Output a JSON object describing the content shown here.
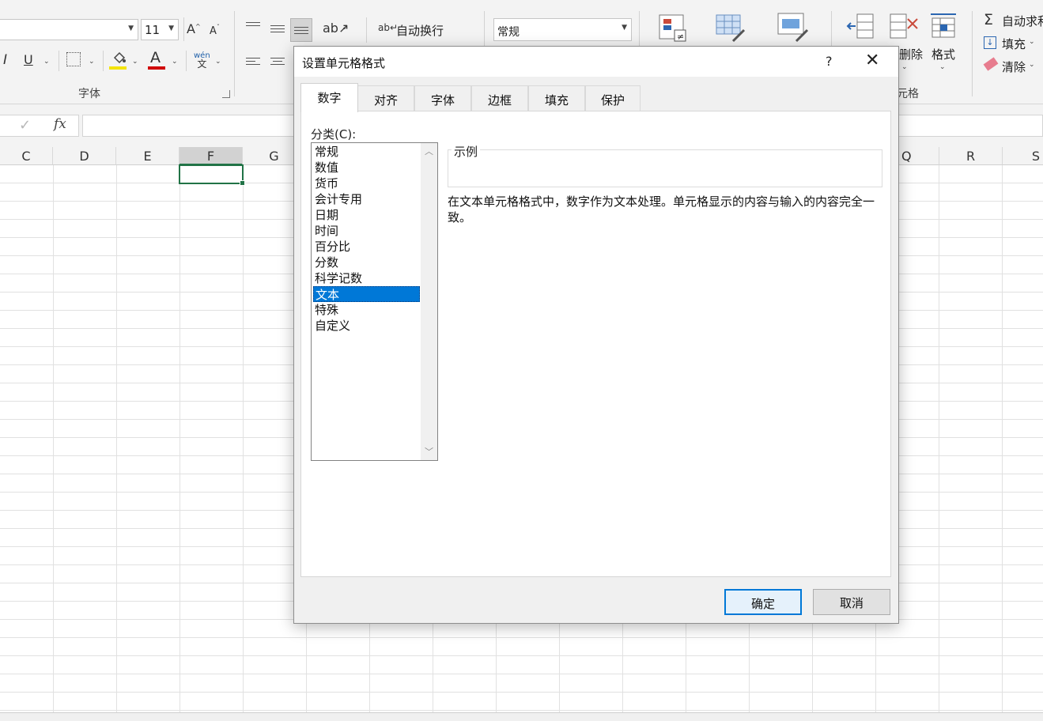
{
  "ribbon": {
    "font_name": "",
    "font_size": "11",
    "grow_font": "A",
    "shrink_font": "A",
    "italic": "I",
    "underline": "U",
    "font_color_glyph": "A",
    "phonetic_top": "wén",
    "phonetic_bottom": "文",
    "font_group_label": "字体",
    "wrap_text": "自动换行",
    "number_format": "常规",
    "delete_label": "删除",
    "format_label": "格式",
    "cells_group_label": "元格",
    "autosum_label": "自动求和",
    "fill_label": "填充",
    "clear_label": "清除",
    "colors": {
      "highlight": "#f4e40b",
      "font_color": "#d00000",
      "accent": "#217346"
    }
  },
  "formula_bar": {
    "fx": "fx",
    "value": ""
  },
  "grid": {
    "columns": [
      "C",
      "D",
      "E",
      "F",
      "G",
      "Q",
      "R",
      "S"
    ],
    "selected_column": "F"
  },
  "dialog": {
    "title": "设置单元格格式",
    "help": "?",
    "close": "✕",
    "tabs": [
      "数字",
      "对齐",
      "字体",
      "边框",
      "填充",
      "保护"
    ],
    "active_tab": "数字",
    "category_label": "分类(C):",
    "categories": [
      "常规",
      "数值",
      "货币",
      "会计专用",
      "日期",
      "时间",
      "百分比",
      "分数",
      "科学记数",
      "文本",
      "特殊",
      "自定义"
    ],
    "selected_category": "文本",
    "sample_label": "示例",
    "description": "在文本单元格格式中，数字作为文本处理。单元格显示的内容与输入的内容完全一致。",
    "ok": "确定",
    "cancel": "取消",
    "colors": {
      "selection": "#0078d7"
    }
  }
}
